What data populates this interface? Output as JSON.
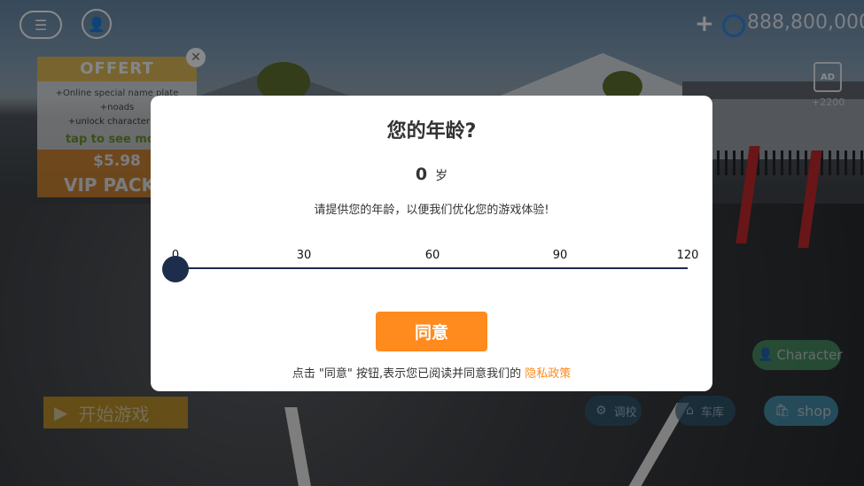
{
  "hud": {
    "menu_icon": "menu-settings-icon",
    "profile_icon": "user-icon",
    "plus": "+",
    "money": "888,800,000",
    "ad_icon_text": "AD",
    "ad_reward": "+2200"
  },
  "offer": {
    "title": "OFFERT",
    "lines": [
      "+Online special name plate",
      "+noads",
      "+unlock character vip"
    ],
    "tap": "tap to see more",
    "price": "$5.98",
    "name": "VIP PACK",
    "close": "✕"
  },
  "bottom": {
    "start": "开始游戏",
    "tune": "调校",
    "garage": "车库",
    "shop": "shop",
    "character": "Character"
  },
  "dialog": {
    "title": "您的年龄?",
    "age_value": "0",
    "age_unit": "岁",
    "description": "请提供您的年龄，以便我们优化您的游戏体验!",
    "ticks": [
      "0",
      "30",
      "60",
      "90",
      "120"
    ],
    "slider_value": 0,
    "slider_max": 120,
    "agree": "同意",
    "footer_prefix": "点击 \"同意\" 按钮,表示您已阅读并同意我们的 ",
    "policy_link": "隐私政策"
  },
  "colors": {
    "accent": "#ff8a1e",
    "slider": "#1f2d4c"
  }
}
